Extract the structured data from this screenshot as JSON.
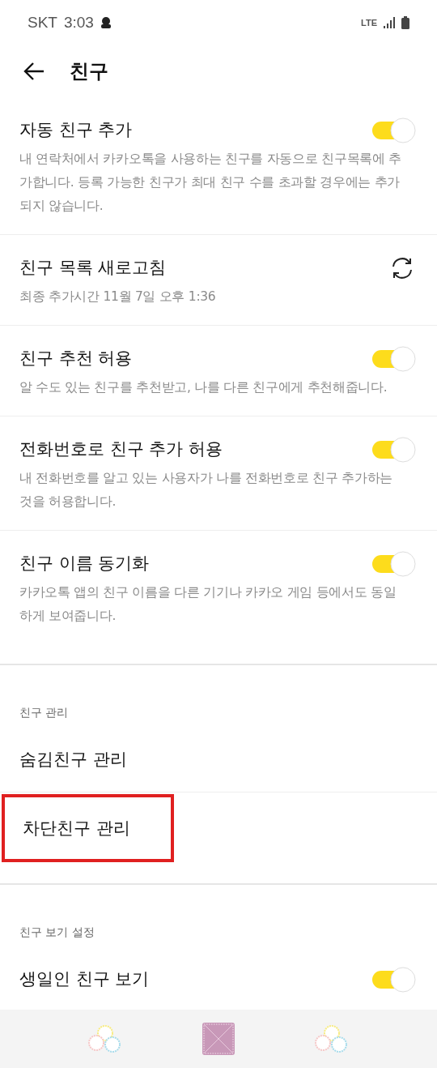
{
  "status_bar": {
    "carrier": "SKT",
    "time": "3:03",
    "network": "LTE"
  },
  "header": {
    "title": "친구"
  },
  "sections": [
    {
      "items": [
        {
          "kind": "toggle",
          "title": "자동 친구 추가",
          "description": "내 연락처에서 카카오톡을 사용하는 친구를 자동으로 친구목록에 추가합니다. 등록 가능한 친구가 최대 친구 수를 초과할 경우에는 추가되지 않습니다.",
          "on": true
        },
        {
          "kind": "refresh",
          "title": "친구 목록 새로고침",
          "description": "최종 추가시간 11월 7일 오후 1:36"
        },
        {
          "kind": "toggle",
          "title": "친구 추천 허용",
          "description": "알 수도 있는 친구를 추천받고, 나를 다른 친구에게 추천해줍니다.",
          "on": true
        },
        {
          "kind": "toggle",
          "title": "전화번호로 친구 추가 허용",
          "description": "내 전화번호를 알고 있는 사용자가 나를 전화번호로 친구 추가하는 것을 허용합니다.",
          "on": true
        },
        {
          "kind": "toggle",
          "title": "친구 이름 동기화",
          "description": "카카오톡 앱의 친구 이름을 다른 기기나 카카오 게임 등에서도 동일하게 보여줍니다.",
          "on": true
        }
      ]
    },
    {
      "label": "친구 관리",
      "items": [
        {
          "kind": "link",
          "title": "숨김친구 관리",
          "highlighted": false
        },
        {
          "kind": "link",
          "title": "차단친구 관리",
          "highlighted": true
        }
      ]
    },
    {
      "label": "친구 보기 설정",
      "items": [
        {
          "kind": "toggle",
          "title": "생일인 친구 보기",
          "on": true
        }
      ]
    }
  ]
}
